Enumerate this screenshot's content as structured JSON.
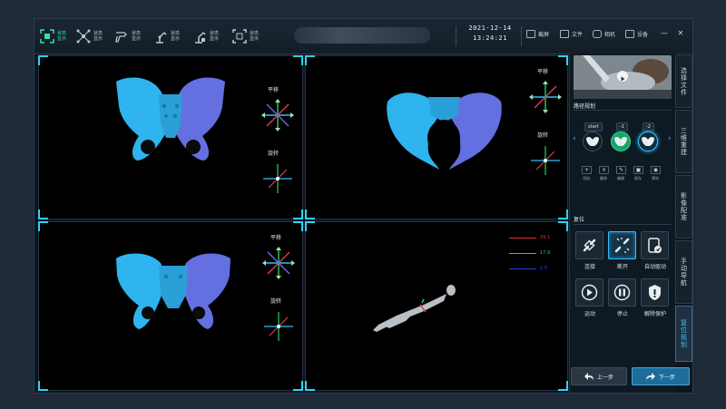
{
  "toolbar": {
    "buttons": [
      {
        "label": "状态显示",
        "icon": "focus-icon",
        "active": true
      },
      {
        "label": "状态显示",
        "icon": "network-icon",
        "active": false
      },
      {
        "label": "状态显示",
        "icon": "drill-icon",
        "active": false
      },
      {
        "label": "状态显示",
        "icon": "robot-arm-icon",
        "active": false
      },
      {
        "label": "状态显示",
        "icon": "robot-arm-icon",
        "active": false
      },
      {
        "label": "状态显示",
        "icon": "frame-icon",
        "active": false
      }
    ],
    "date": "2021-12-14",
    "time": "13:24:21",
    "tools": [
      {
        "label": "截屏",
        "icon": "screenshot-icon"
      },
      {
        "label": "文件",
        "icon": "folder-icon"
      },
      {
        "label": "相机",
        "icon": "camera-icon"
      },
      {
        "label": "设备",
        "icon": "device-icon"
      }
    ]
  },
  "viewports": {
    "pan_label": "平移",
    "rotate_label": "旋转",
    "legend": [
      {
        "value": "39.1",
        "color": "#e03030"
      },
      {
        "value": "17.9",
        "color": "#2fd05a"
      },
      {
        "value": "0.0",
        "color": "#2f3fe0"
      }
    ]
  },
  "colors": {
    "bone_primary": "#2fb4f0",
    "bone_secondary": "#6470e0",
    "accent": "#2fbfff",
    "active_step": "#19a46b"
  },
  "panel": {
    "path_planning_title": "路径规划",
    "steps": [
      {
        "tag": "start"
      },
      {
        "tag": "-1"
      },
      {
        "tag": "-2"
      }
    ],
    "tools": [
      {
        "label": "添加",
        "symbol": "+"
      },
      {
        "label": "删除",
        "symbol": "×"
      },
      {
        "label": "编辑",
        "symbol": "✎"
      },
      {
        "label": "保存",
        "symbol": "▣"
      },
      {
        "label": "预览",
        "symbol": "◉"
      }
    ],
    "reset_title": "复位",
    "controls": [
      {
        "label": "连接",
        "icon": "connect-icon"
      },
      {
        "label": "断开",
        "icon": "disconnect-icon"
      },
      {
        "label": "自动驱动",
        "icon": "auto-drive-icon"
      },
      {
        "label": "运动",
        "icon": "play-icon"
      },
      {
        "label": "停止",
        "icon": "pause-icon"
      },
      {
        "label": "解除保护",
        "icon": "unlock-icon"
      }
    ],
    "prev_label": "上一步",
    "next_label": "下一步"
  },
  "sidetabs": [
    {
      "label": "选择文件",
      "active": false
    },
    {
      "label": "三维重建",
      "active": false
    },
    {
      "label": "影像配准",
      "active": false
    },
    {
      "label": "手动导航",
      "active": false
    },
    {
      "label": "复位规划",
      "active": true
    }
  ]
}
